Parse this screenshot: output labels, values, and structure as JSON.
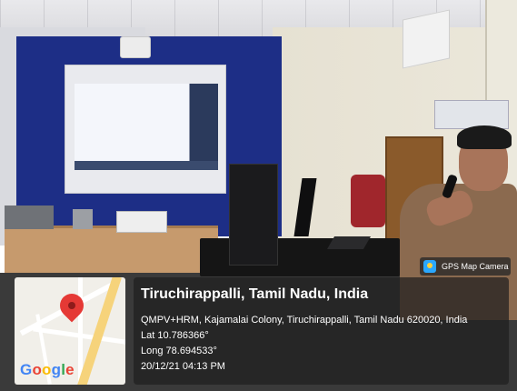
{
  "badge": {
    "icon": "gps-map-camera-icon",
    "label": "GPS Map Camera"
  },
  "location": {
    "title": "Tiruchirappalli, Tamil Nadu, India",
    "address": "QMPV+HRM, Kajamalai Colony, Tiruchirappalli, Tamil Nadu 620020, India",
    "lat": "Lat 10.786366°",
    "long": "Long 78.694533°",
    "datetime": "20/12/21 04:13 PM"
  },
  "map": {
    "pin_icon": "location-pin-icon",
    "logo_text": "Google",
    "logo_colors": [
      "#4285F4",
      "#EA4335",
      "#FBBC05",
      "#4285F4",
      "#34A853",
      "#EA4335"
    ]
  }
}
